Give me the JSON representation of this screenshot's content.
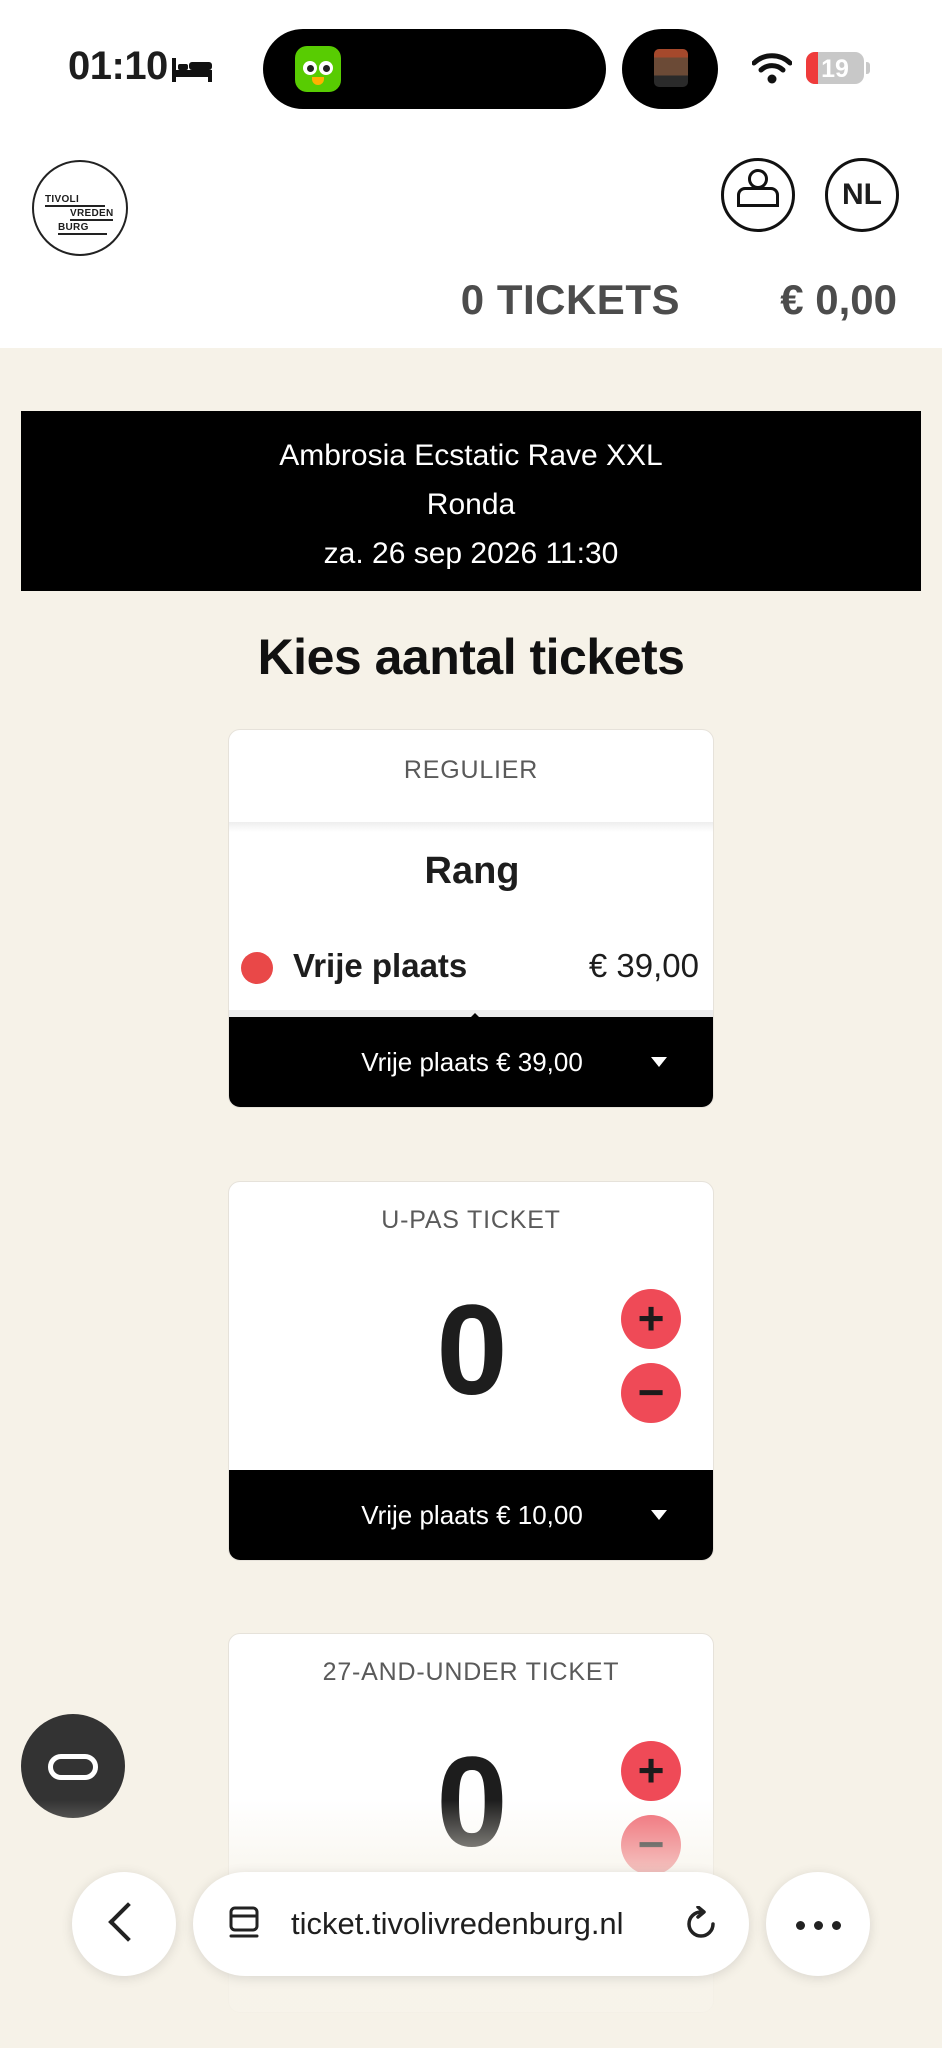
{
  "status_bar": {
    "time": "01:10",
    "battery": "19",
    "icons": [
      "bed-icon",
      "duolingo-icon",
      "media-thumbnail-icon",
      "wifi-icon",
      "battery-icon"
    ]
  },
  "header": {
    "logo_lines": [
      "TIVOLI",
      "VREDEN",
      "BURG"
    ],
    "language": "NL",
    "ticket_count": "0 TICKETS",
    "total": "€ 0,00"
  },
  "event": {
    "name": "Ambrosia Ecstatic Rave XXL",
    "section": "Ronda",
    "datetime": "za. 26 sep 2026   11:30"
  },
  "heading": "Kies aantal tickets",
  "cards": [
    {
      "label": "REGULIER",
      "title": "Rang",
      "seat_name": "Vrije plaats",
      "seat_price": "€ 39,00",
      "seat_color": "#e94848",
      "footer": "Vrije plaats  € 39,00"
    },
    {
      "label": "U-PAS TICKET",
      "quantity": "0",
      "plus": "+",
      "minus": "−",
      "footer": "Vrije plaats  € 10,00"
    },
    {
      "label": "27-AND-UNDER TICKET",
      "quantity": "0",
      "plus": "+",
      "minus": "−"
    }
  ],
  "browser": {
    "url": "ticket.tivolivredenburg.nl"
  },
  "colors": {
    "accent": "#ef4a57",
    "background": "#f6f2e8",
    "banner": "#000000"
  }
}
